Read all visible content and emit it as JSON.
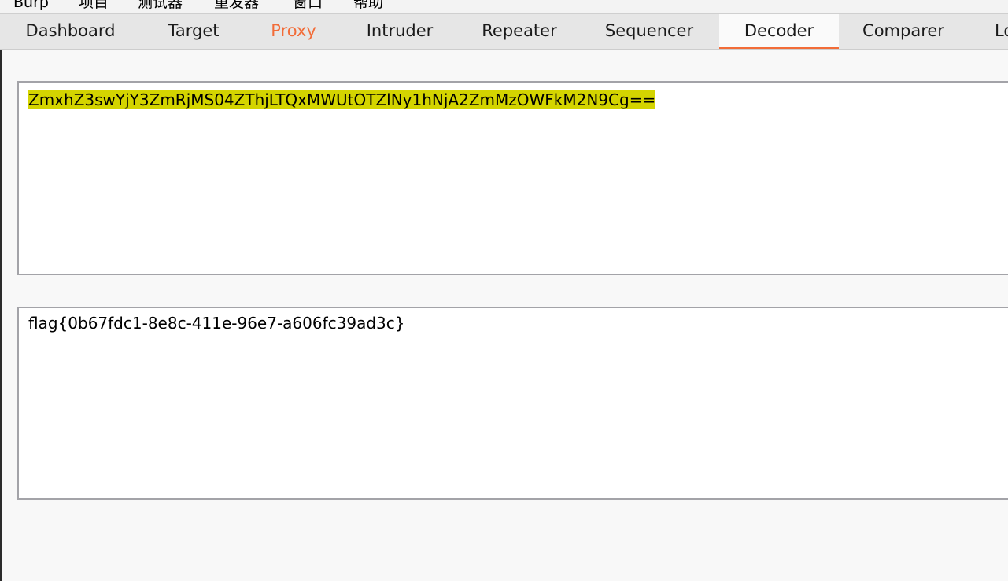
{
  "menubar": {
    "items": [
      "Burp",
      "项目",
      "测试器",
      "重发器",
      "窗口",
      "帮助"
    ]
  },
  "tabs": [
    {
      "label": "Dashboard"
    },
    {
      "label": "Target"
    },
    {
      "label": "Proxy"
    },
    {
      "label": "Intruder"
    },
    {
      "label": "Repeater"
    },
    {
      "label": "Sequencer"
    },
    {
      "label": "Decoder"
    },
    {
      "label": "Comparer"
    },
    {
      "label": "Lo"
    }
  ],
  "active_tab": "Decoder",
  "highlighted_tab": "Proxy",
  "colors": {
    "accent": "#f26c38",
    "selection": "#d4d400"
  },
  "decoder": {
    "input_text": "ZmxhZ3swYjY3ZmRjMS04ZThjLTQxMWUtOTZlNy1hNjA2ZmMzOWFkM2N9Cg==",
    "output_text": "flag{0b67fdc1-8e8c-411e-96e7-a606fc39ad3c}"
  }
}
